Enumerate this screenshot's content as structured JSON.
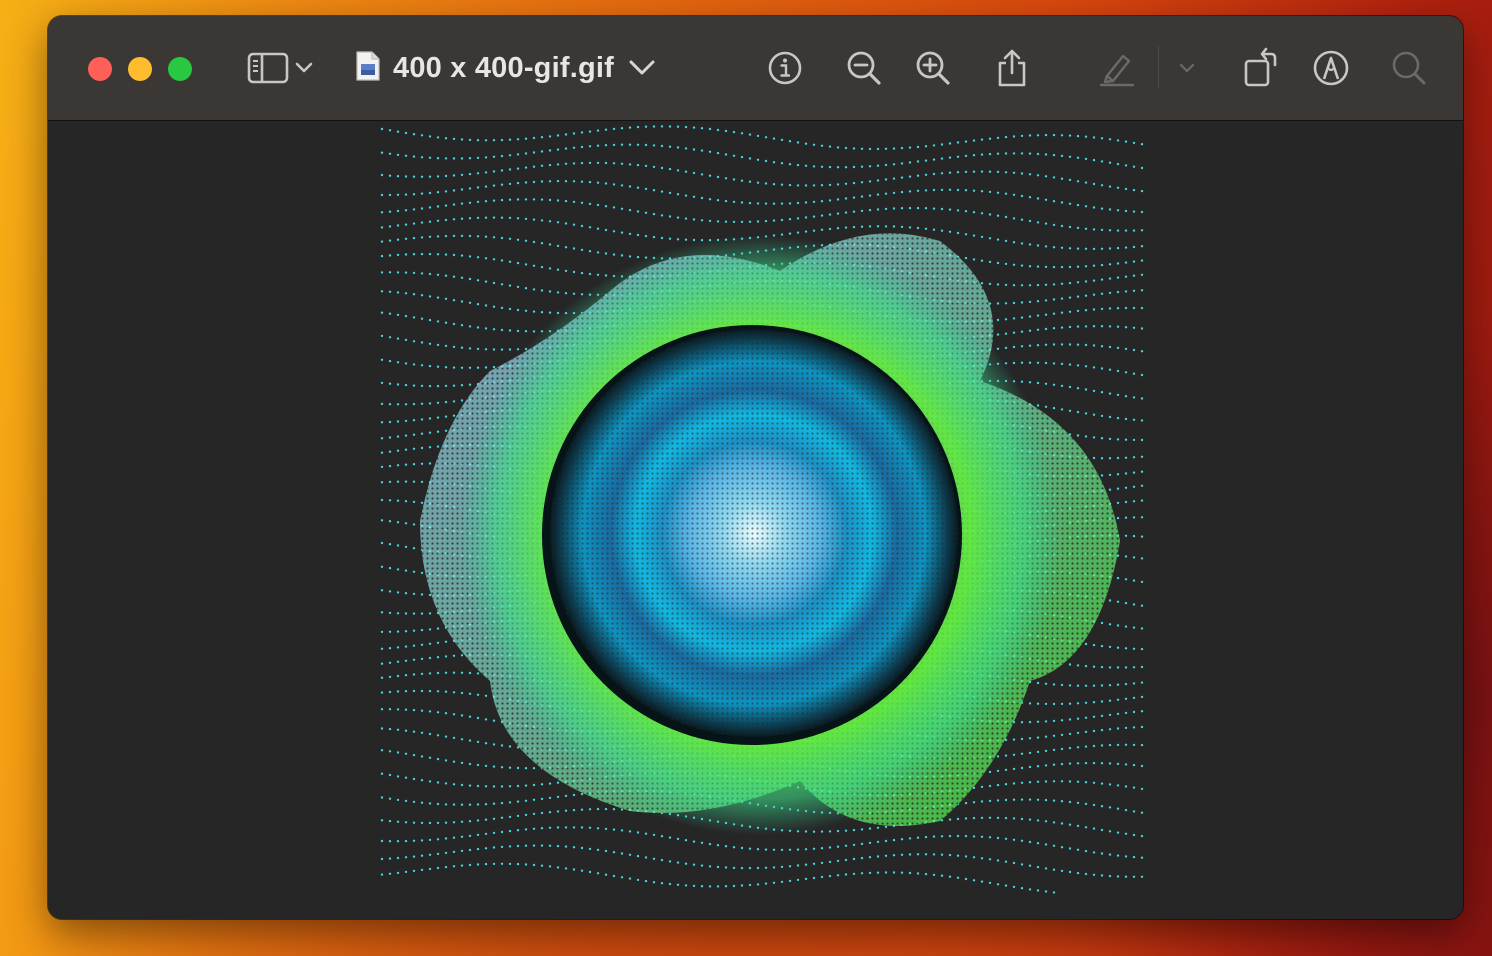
{
  "window": {
    "document_title": "400 x 400-gif.gif"
  },
  "toolbar": {
    "buttons": [
      {
        "name": "sidebar-icon"
      },
      {
        "name": "chevron-down-icon"
      },
      {
        "name": "info-icon"
      },
      {
        "name": "zoom-out-icon"
      },
      {
        "name": "zoom-in-icon"
      },
      {
        "name": "share-icon"
      },
      {
        "name": "highlight-icon"
      },
      {
        "name": "rotate-icon"
      },
      {
        "name": "markup-icon"
      },
      {
        "name": "search-icon"
      }
    ]
  },
  "colors": {
    "close": "#fe5f57",
    "minimize": "#febc2e",
    "maximize": "#28c840",
    "toolbar_bg": "#3a3735",
    "content_bg": "#262626",
    "icon": "#c9c6c3",
    "icon_disabled": "#6c6967"
  },
  "image": {
    "description_icon": "image-file-icon"
  }
}
